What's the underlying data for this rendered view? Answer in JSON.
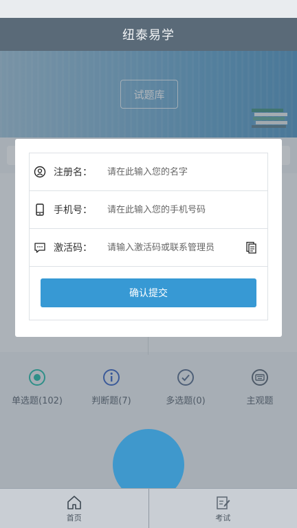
{
  "header": {
    "title": "纽泰易学"
  },
  "hero": {
    "question_bank_label": "试题库"
  },
  "categories": [
    {
      "label": "单选题(102)",
      "icon": "radio-icon"
    },
    {
      "label": "判断题(7)",
      "icon": "info-icon"
    },
    {
      "label": "多选题(0)",
      "icon": "check-circle-icon"
    },
    {
      "label": "主观题",
      "icon": "keyboard-icon"
    }
  ],
  "tabbar": {
    "tabs": [
      {
        "label": "首页",
        "icon": "home-icon"
      },
      {
        "label": "考试",
        "icon": "edit-icon"
      }
    ]
  },
  "dialog": {
    "fields": [
      {
        "label": "注册名：",
        "placeholder": "请在此输入您的名字",
        "icon": "user-icon"
      },
      {
        "label": "手机号：",
        "placeholder": "请在此输入您的手机号码",
        "icon": "phone-icon"
      },
      {
        "label": "激活码：",
        "placeholder": "请输入激活码或联系管理员",
        "icon": "message-icon"
      }
    ],
    "submit_label": "确认提交"
  },
  "colors": {
    "accent": "#3799d4",
    "header_bg": "#5a6a78"
  }
}
